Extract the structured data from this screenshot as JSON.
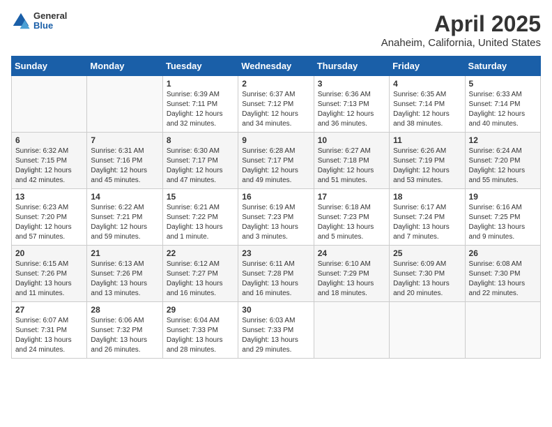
{
  "header": {
    "logo_general": "General",
    "logo_blue": "Blue",
    "title": "April 2025",
    "subtitle": "Anaheim, California, United States"
  },
  "weekdays": [
    "Sunday",
    "Monday",
    "Tuesday",
    "Wednesday",
    "Thursday",
    "Friday",
    "Saturday"
  ],
  "weeks": [
    [
      {
        "day": "",
        "info": ""
      },
      {
        "day": "",
        "info": ""
      },
      {
        "day": "1",
        "info": "Sunrise: 6:39 AM\nSunset: 7:11 PM\nDaylight: 12 hours and 32 minutes."
      },
      {
        "day": "2",
        "info": "Sunrise: 6:37 AM\nSunset: 7:12 PM\nDaylight: 12 hours and 34 minutes."
      },
      {
        "day": "3",
        "info": "Sunrise: 6:36 AM\nSunset: 7:13 PM\nDaylight: 12 hours and 36 minutes."
      },
      {
        "day": "4",
        "info": "Sunrise: 6:35 AM\nSunset: 7:14 PM\nDaylight: 12 hours and 38 minutes."
      },
      {
        "day": "5",
        "info": "Sunrise: 6:33 AM\nSunset: 7:14 PM\nDaylight: 12 hours and 40 minutes."
      }
    ],
    [
      {
        "day": "6",
        "info": "Sunrise: 6:32 AM\nSunset: 7:15 PM\nDaylight: 12 hours and 42 minutes."
      },
      {
        "day": "7",
        "info": "Sunrise: 6:31 AM\nSunset: 7:16 PM\nDaylight: 12 hours and 45 minutes."
      },
      {
        "day": "8",
        "info": "Sunrise: 6:30 AM\nSunset: 7:17 PM\nDaylight: 12 hours and 47 minutes."
      },
      {
        "day": "9",
        "info": "Sunrise: 6:28 AM\nSunset: 7:17 PM\nDaylight: 12 hours and 49 minutes."
      },
      {
        "day": "10",
        "info": "Sunrise: 6:27 AM\nSunset: 7:18 PM\nDaylight: 12 hours and 51 minutes."
      },
      {
        "day": "11",
        "info": "Sunrise: 6:26 AM\nSunset: 7:19 PM\nDaylight: 12 hours and 53 minutes."
      },
      {
        "day": "12",
        "info": "Sunrise: 6:24 AM\nSunset: 7:20 PM\nDaylight: 12 hours and 55 minutes."
      }
    ],
    [
      {
        "day": "13",
        "info": "Sunrise: 6:23 AM\nSunset: 7:20 PM\nDaylight: 12 hours and 57 minutes."
      },
      {
        "day": "14",
        "info": "Sunrise: 6:22 AM\nSunset: 7:21 PM\nDaylight: 12 hours and 59 minutes."
      },
      {
        "day": "15",
        "info": "Sunrise: 6:21 AM\nSunset: 7:22 PM\nDaylight: 13 hours and 1 minute."
      },
      {
        "day": "16",
        "info": "Sunrise: 6:19 AM\nSunset: 7:23 PM\nDaylight: 13 hours and 3 minutes."
      },
      {
        "day": "17",
        "info": "Sunrise: 6:18 AM\nSunset: 7:23 PM\nDaylight: 13 hours and 5 minutes."
      },
      {
        "day": "18",
        "info": "Sunrise: 6:17 AM\nSunset: 7:24 PM\nDaylight: 13 hours and 7 minutes."
      },
      {
        "day": "19",
        "info": "Sunrise: 6:16 AM\nSunset: 7:25 PM\nDaylight: 13 hours and 9 minutes."
      }
    ],
    [
      {
        "day": "20",
        "info": "Sunrise: 6:15 AM\nSunset: 7:26 PM\nDaylight: 13 hours and 11 minutes."
      },
      {
        "day": "21",
        "info": "Sunrise: 6:13 AM\nSunset: 7:26 PM\nDaylight: 13 hours and 13 minutes."
      },
      {
        "day": "22",
        "info": "Sunrise: 6:12 AM\nSunset: 7:27 PM\nDaylight: 13 hours and 16 minutes."
      },
      {
        "day": "23",
        "info": "Sunrise: 6:11 AM\nSunset: 7:28 PM\nDaylight: 13 hours and 16 minutes."
      },
      {
        "day": "24",
        "info": "Sunrise: 6:10 AM\nSunset: 7:29 PM\nDaylight: 13 hours and 18 minutes."
      },
      {
        "day": "25",
        "info": "Sunrise: 6:09 AM\nSunset: 7:30 PM\nDaylight: 13 hours and 20 minutes."
      },
      {
        "day": "26",
        "info": "Sunrise: 6:08 AM\nSunset: 7:30 PM\nDaylight: 13 hours and 22 minutes."
      }
    ],
    [
      {
        "day": "27",
        "info": "Sunrise: 6:07 AM\nSunset: 7:31 PM\nDaylight: 13 hours and 24 minutes."
      },
      {
        "day": "28",
        "info": "Sunrise: 6:06 AM\nSunset: 7:32 PM\nDaylight: 13 hours and 26 minutes."
      },
      {
        "day": "29",
        "info": "Sunrise: 6:04 AM\nSunset: 7:33 PM\nDaylight: 13 hours and 28 minutes."
      },
      {
        "day": "30",
        "info": "Sunrise: 6:03 AM\nSunset: 7:33 PM\nDaylight: 13 hours and 29 minutes."
      },
      {
        "day": "",
        "info": ""
      },
      {
        "day": "",
        "info": ""
      },
      {
        "day": "",
        "info": ""
      }
    ]
  ]
}
